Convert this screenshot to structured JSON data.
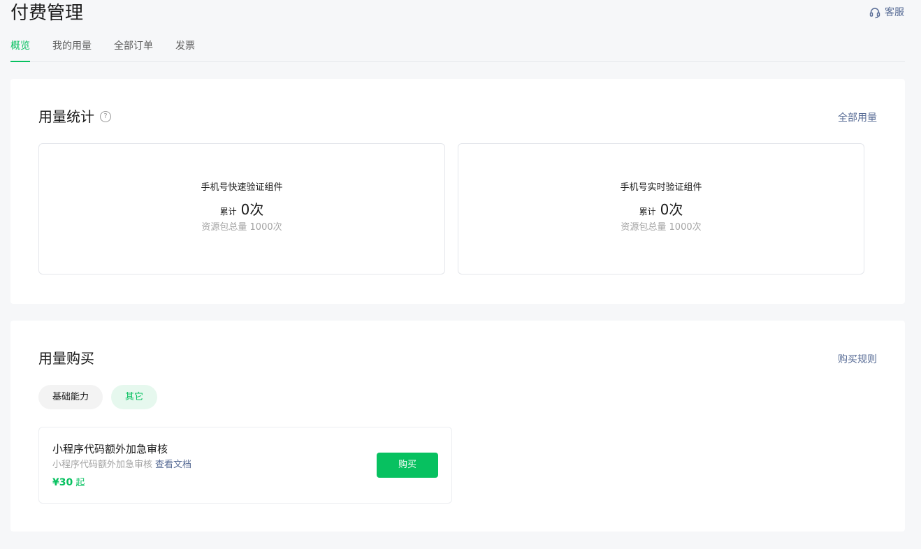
{
  "header": {
    "title": "付费管理",
    "service_label": "客服"
  },
  "tabs": [
    {
      "label": "概览",
      "active": true
    },
    {
      "label": "我的用量",
      "active": false
    },
    {
      "label": "全部订单",
      "active": false
    },
    {
      "label": "发票",
      "active": false
    }
  ],
  "usage_stats": {
    "title": "用量统计",
    "help_glyph": "?",
    "link_label": "全部用量",
    "items": [
      {
        "name": "手机号快速验证组件",
        "count_prefix": "累计",
        "count": "0次",
        "total": "资源包总量 1000次"
      },
      {
        "name": "手机号实时验证组件",
        "count_prefix": "累计",
        "count": "0次",
        "total": "资源包总量 1000次"
      }
    ]
  },
  "usage_purchase": {
    "title": "用量购买",
    "link_label": "购买规则",
    "filters": [
      {
        "label": "基础能力",
        "active": false
      },
      {
        "label": "其它",
        "active": true
      }
    ],
    "product": {
      "name": "小程序代码额外加急审核",
      "description": "小程序代码额外加急审核",
      "doc_link": "查看文档",
      "price": "¥30",
      "price_suffix": "起",
      "buy_label": "购买"
    }
  },
  "colors": {
    "accent": "#07c160",
    "link": "#576b95",
    "background": "#f6f7f9"
  }
}
